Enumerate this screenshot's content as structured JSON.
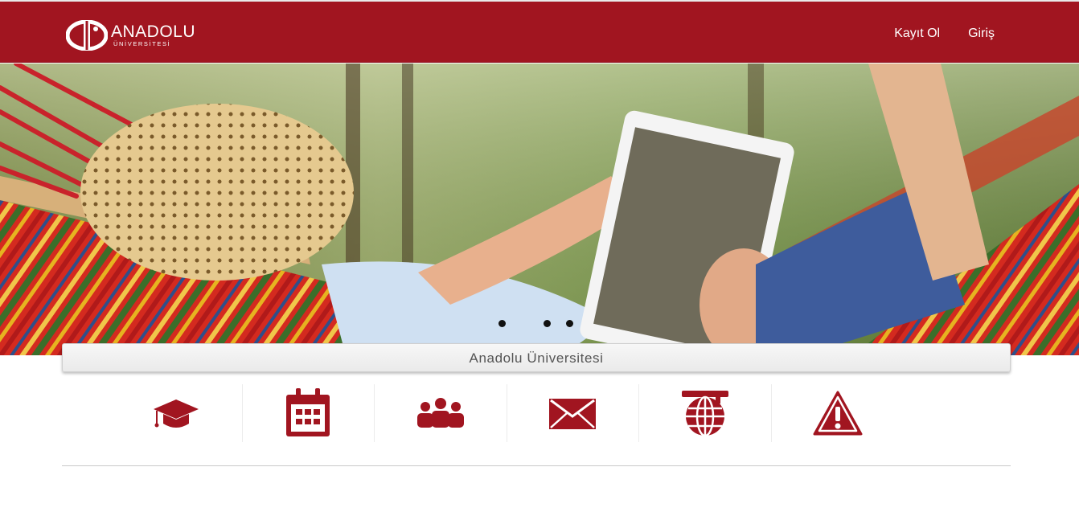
{
  "brand": {
    "name": "ANADOLU",
    "sub": "ÜNİVERSİTESİ",
    "color": "#a11520"
  },
  "nav": {
    "register_label": "Kayıt Ol",
    "login_label": "Giriş"
  },
  "carousel": {
    "slide_count": 3,
    "active_index": 0
  },
  "section": {
    "title": "Anadolu Üniversitesi"
  },
  "quick_links": [
    {
      "icon": "graduation-cap-icon"
    },
    {
      "icon": "calendar-icon"
    },
    {
      "icon": "users-group-icon"
    },
    {
      "icon": "envelope-icon"
    },
    {
      "icon": "university-globe-icon"
    },
    {
      "icon": "warning-icon"
    }
  ]
}
